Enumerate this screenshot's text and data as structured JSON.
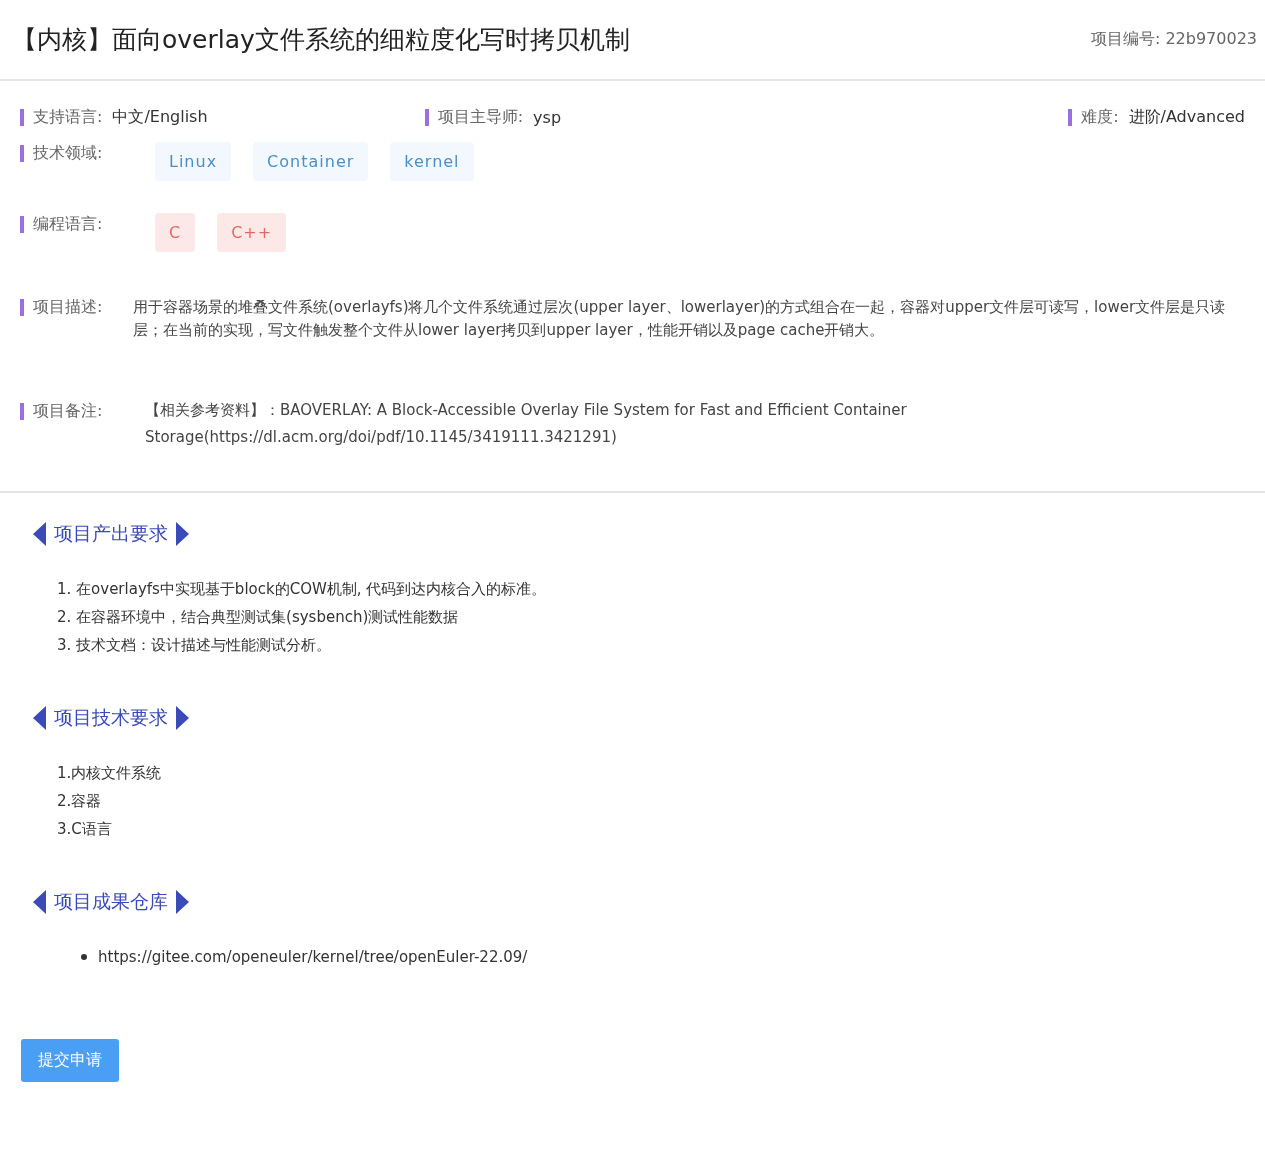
{
  "header": {
    "title": "【内核】面向overlay文件系统的细粒度化写时拷贝机制",
    "project_number": "项目编号: 22b970023"
  },
  "summary": [
    {
      "label": "支持语言:",
      "value": "中文/English"
    },
    {
      "label": "项目主导师:",
      "value": "ysp"
    },
    {
      "label": "难度:",
      "value": "进阶/Advanced"
    }
  ],
  "details": [
    {
      "kind": "field-tags",
      "label": "技术领域:",
      "tags": [
        "Linux",
        "Container",
        "kernel"
      ]
    },
    {
      "kind": "language-tags",
      "label": "编程语言:",
      "tags": [
        "C",
        "C++"
      ]
    },
    {
      "kind": "text",
      "label": "项目描述:",
      "text": "用于容器场景的堆叠文件系统(overlayfs)将几个文件系统通过层次(upper layer、lowerlayer)的方式组合在一起，容器对upper文件层可读写，lower文件层是只读层；在当前的实现，写文件触发整个文件从lower layer拷贝到upper layer，性能开销以及page cache开销大。"
    },
    {
      "kind": "note",
      "label": "项目备注:",
      "text": "【相关参考资料】：BAOVERLAY: A Block-Accessible Overlay File System for Fast and Efficient Container Storage(https://dl.acm.org/doi/pdf/10.1145/3419111.3421291)"
    }
  ],
  "sections": [
    {
      "title": "项目产出要求",
      "kind": "numbered",
      "items": [
        "1. 在overlayfs中实现基于block的COW机制, 代码到达内核合入的标准。",
        "2. 在容器环境中，结合典型测试集(sysbench)测试性能数据",
        "3. 技术文档：设计描述与性能测试分析。"
      ]
    },
    {
      "title": "项目技术要求",
      "kind": "numbered",
      "items": [
        "1.内核文件系统",
        "2.容器",
        "3.C语言"
      ]
    },
    {
      "title": "项目成果仓库",
      "kind": "bullet",
      "items": [
        "https://gitee.com/openeuler/kernel/tree/openEuler-22.09/"
      ]
    }
  ],
  "submit_button": "提交申请"
}
